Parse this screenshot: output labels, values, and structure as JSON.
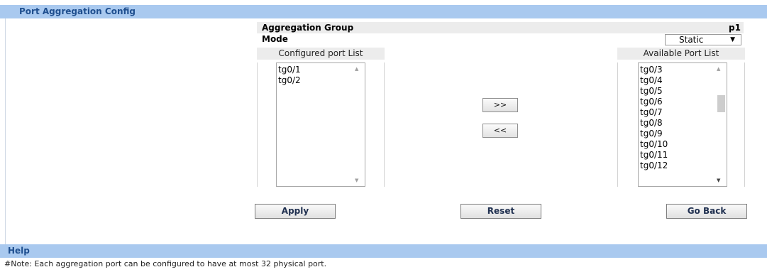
{
  "title_bar": {
    "label": "Port Aggregation Config"
  },
  "aggregation_group": {
    "label": "Aggregation Group",
    "value": "p1"
  },
  "mode": {
    "label": "Mode",
    "selected": "Static"
  },
  "configured_list": {
    "header": "Configured port List",
    "items": [
      "tg0/1",
      "tg0/2"
    ]
  },
  "available_list": {
    "header": "Available Port List",
    "items": [
      "tg0/3",
      "tg0/4",
      "tg0/5",
      "tg0/6",
      "tg0/7",
      "tg0/8",
      "tg0/9",
      "tg0/10",
      "tg0/11",
      "tg0/12"
    ]
  },
  "buttons": {
    "add": ">>",
    "remove": "<<",
    "apply": "Apply",
    "reset": "Reset",
    "go_back": "Go Back"
  },
  "help_bar": {
    "label": "Help"
  },
  "note": "#Note: Each aggregation port can be configured to have at most 32 physical port.",
  "colors": {
    "header_bar": "#a9c9ef",
    "header_text": "#1f4f8f"
  },
  "icons": {
    "dropdown": "chevron-down-icon",
    "scroll_up": "scroll-up-arrow-icon",
    "scroll_down": "scroll-down-arrow-icon"
  }
}
